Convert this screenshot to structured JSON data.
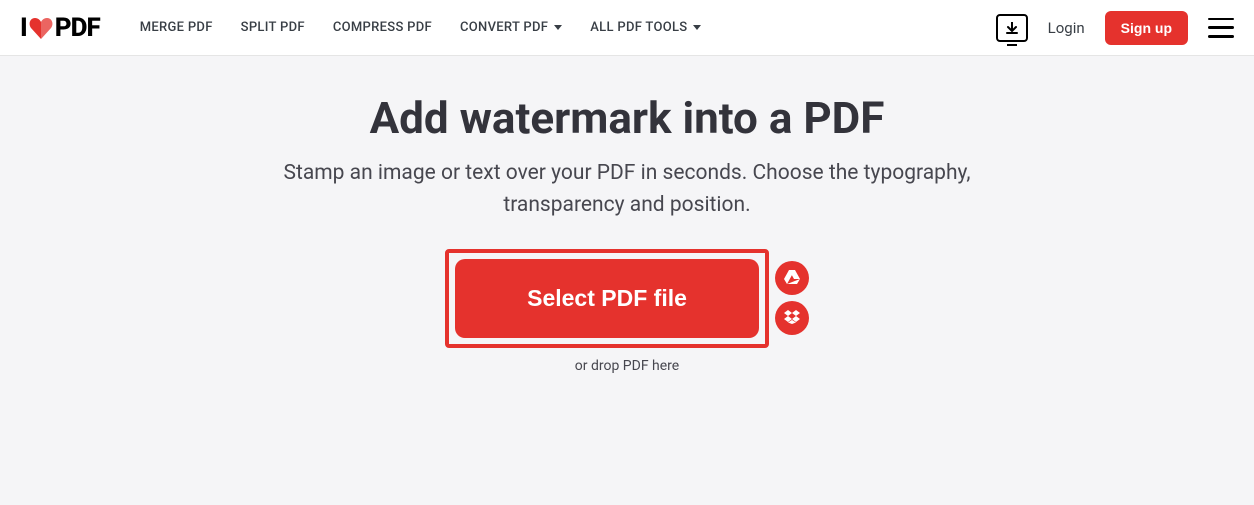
{
  "logo": {
    "prefix": "I",
    "suffix": "PDF"
  },
  "nav": {
    "merge": "MERGE PDF",
    "split": "SPLIT PDF",
    "compress": "COMPRESS PDF",
    "convert": "CONVERT PDF",
    "all_tools": "ALL PDF TOOLS"
  },
  "header": {
    "login": "Login",
    "signup": "Sign up"
  },
  "main": {
    "title": "Add watermark into a PDF",
    "subtitle": "Stamp an image or text over your PDF in seconds. Choose the typography, transparency and position.",
    "select_button": "Select PDF file",
    "drop_hint": "or drop PDF here"
  }
}
